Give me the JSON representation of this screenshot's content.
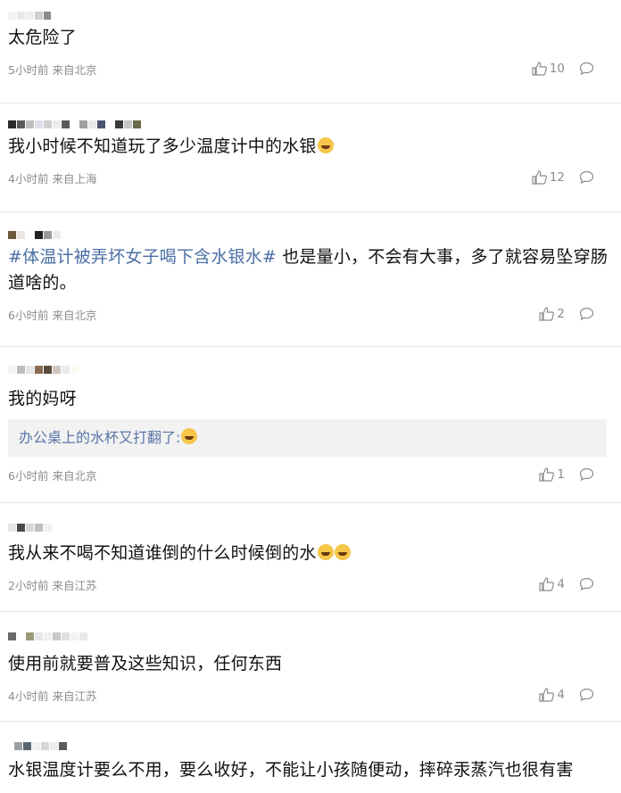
{
  "comments": [
    {
      "text": "太危险了",
      "time": "5小时前",
      "location": "来自北京",
      "likes": "10"
    },
    {
      "text": "我小时候不知道玩了多少温度计中的水银",
      "time": "4小时前",
      "location": "来自上海",
      "likes": "12"
    },
    {
      "tag": "#体温计被弄坏女子喝下含水银水#",
      "text": " 也是量小，不会有大事，多了就容易坠穿肠道啥的。",
      "time": "6小时前",
      "location": "来自北京",
      "likes": "2"
    },
    {
      "text": "我的妈呀",
      "quote": "办公桌上的水杯又打翻了:",
      "time": "6小时前",
      "location": "来自北京",
      "likes": "1"
    },
    {
      "text": "我从来不喝不知道谁倒的什么时候倒的水",
      "time": "2小时前",
      "location": "来自江苏",
      "likes": "4"
    },
    {
      "text": "使用前就要普及这些知识，任何东西",
      "time": "4小时前",
      "location": "来自江苏",
      "likes": "4"
    },
    {
      "text": "水银温度计要么不用，要么收好，不能让小孩随便动，摔碎汞蒸汽也很有害"
    }
  ],
  "icons": {
    "like": "thumbs-up-icon",
    "reply": "comment-bubble-icon",
    "emoji": "crying-laughing-emoji"
  }
}
